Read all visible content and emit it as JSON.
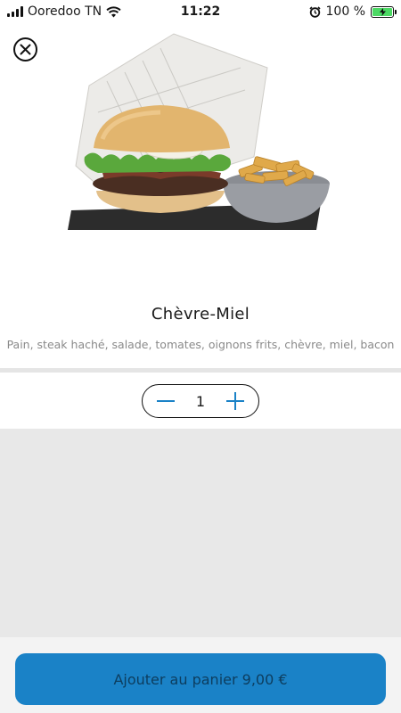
{
  "status_bar": {
    "carrier": "Ooredoo TN",
    "time": "11:22",
    "battery": "100 %"
  },
  "product": {
    "title": "Chèvre-Miel",
    "description": "Pain, steak haché, salade, tomates, oignons frits, chèvre, miel, bacon"
  },
  "quantity": {
    "value": "1"
  },
  "cart": {
    "button_label": "Ajouter au panier 9,00 €"
  },
  "colors": {
    "accent": "#1a82c7",
    "divider": "#e5e5e5",
    "grey_area": "#e8e8e8"
  },
  "icons": [
    "signal-icon",
    "wifi-icon",
    "alarm-icon",
    "battery-icon",
    "close-icon",
    "minus-icon",
    "plus-icon"
  ]
}
